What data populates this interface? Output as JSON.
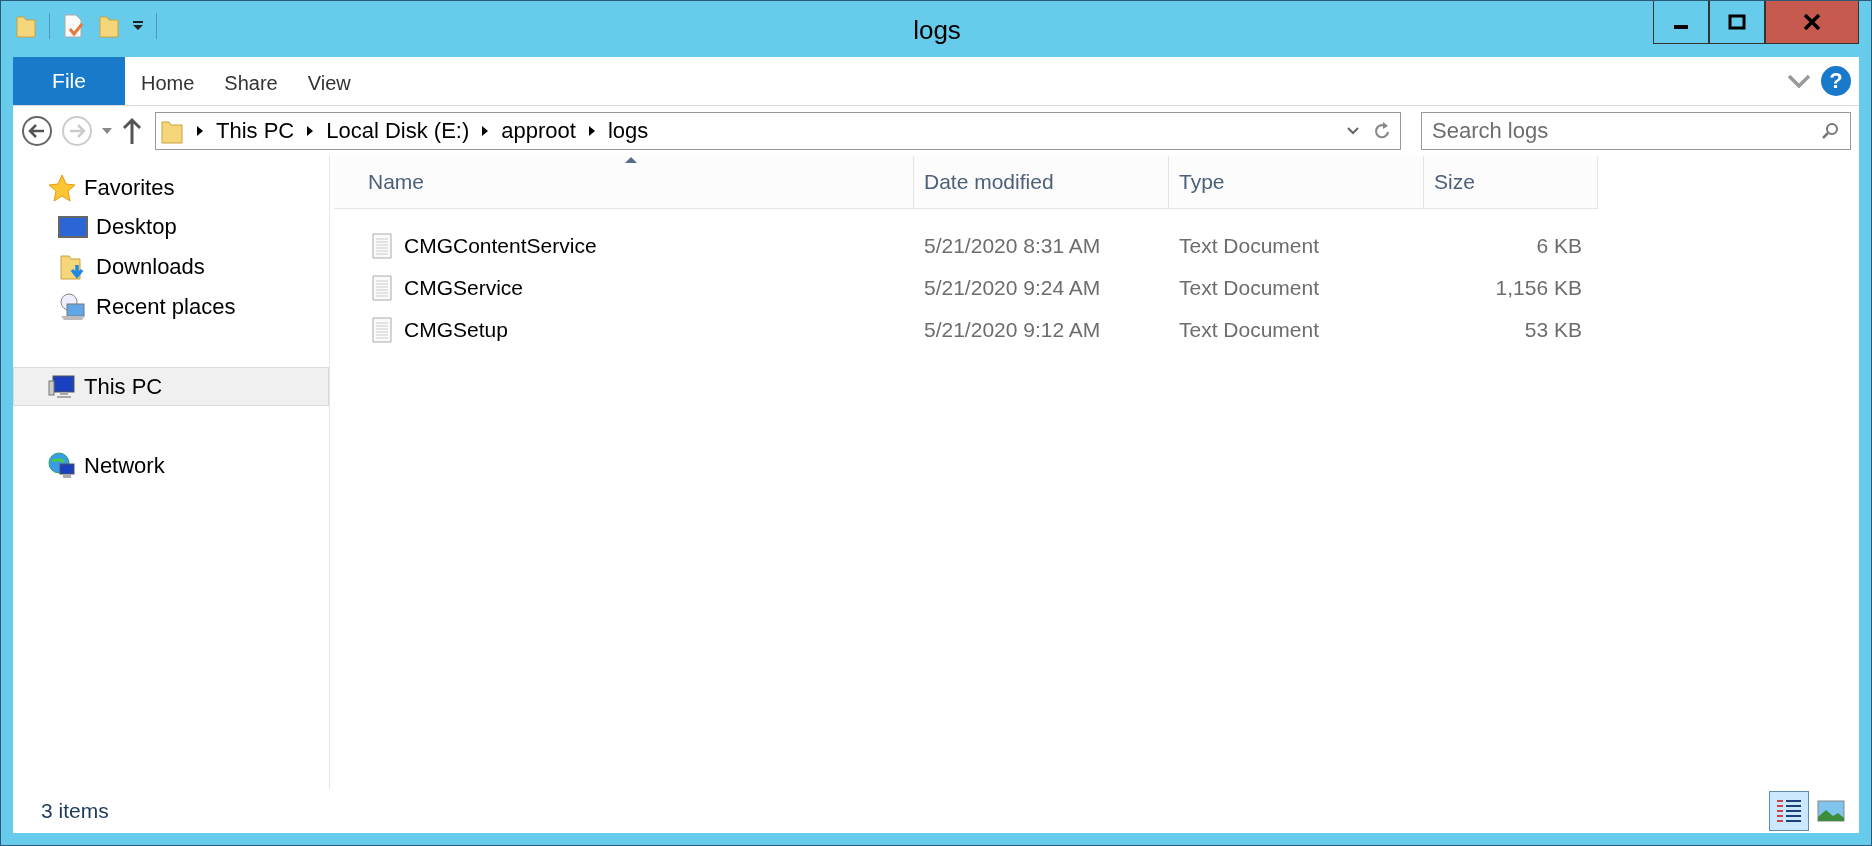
{
  "window": {
    "title": "logs"
  },
  "help": "?",
  "ribbon_tabs": [
    {
      "label": "File",
      "kind": "file"
    },
    {
      "label": "Home",
      "kind": "tab"
    },
    {
      "label": "Share",
      "kind": "tab"
    },
    {
      "label": "View",
      "kind": "tab"
    }
  ],
  "address": {
    "crumbs": [
      "This PC",
      "Local Disk (E:)",
      "approot",
      "logs"
    ]
  },
  "search": {
    "placeholder": "Search logs"
  },
  "sidebar": {
    "items": [
      {
        "label": "Favorites",
        "selected": false,
        "children": [
          {
            "label": "Desktop",
            "selected": false
          },
          {
            "label": "Downloads",
            "selected": false
          },
          {
            "label": "Recent places",
            "selected": false
          }
        ]
      },
      {
        "label": "This PC",
        "selected": true
      },
      {
        "label": "Network",
        "selected": false
      }
    ]
  },
  "table": {
    "columns": [
      {
        "label": "Name",
        "sorted": true
      },
      {
        "label": "Date modified",
        "sorted": false
      },
      {
        "label": "Type",
        "sorted": false
      },
      {
        "label": "Size",
        "sorted": false
      }
    ],
    "rows": [
      {
        "name": "CMGContentService",
        "date": "5/21/2020 8:31 AM",
        "type": "Text Document",
        "size": "6 KB"
      },
      {
        "name": "CMGService",
        "date": "5/21/2020 9:24 AM",
        "type": "Text Document",
        "size": "1,156 KB"
      },
      {
        "name": "CMGSetup",
        "date": "5/21/2020 9:12 AM",
        "type": "Text Document",
        "size": "53 KB"
      }
    ]
  },
  "status_bar": {
    "text": "3 items",
    "view_buttons": [
      {
        "kind": "details",
        "selected": true
      },
      {
        "kind": "thumbnails",
        "selected": false
      }
    ]
  }
}
